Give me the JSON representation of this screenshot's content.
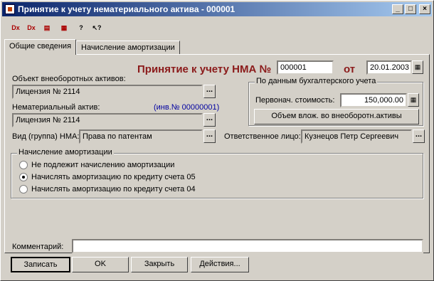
{
  "window": {
    "title": "Принятие к учету нематериального актива - 000001"
  },
  "toolbar": {
    "icons": [
      "delete-doc-icon",
      "delete-mark-icon",
      "doc-edit-icon",
      "doc-list-icon",
      "help-icon",
      "pointer-help-icon"
    ]
  },
  "tabs": {
    "general": "Общие сведения",
    "amortization": "Начисление амортизации"
  },
  "header": {
    "title": "Принятие к учету НМА №",
    "number": "000001",
    "date_label": "от",
    "date": "20.01.2003"
  },
  "asset": {
    "label": "Объект внеоборотных активов:",
    "value": "Лицензия № 2114"
  },
  "nma": {
    "label": "Нематериальный актив:",
    "inv": "(инв.№ 00000001)",
    "value": "Лицензия № 2114"
  },
  "kind": {
    "label": "Вид (группа) НМА:",
    "value": "Права по патентам"
  },
  "accounting": {
    "group_title": "По данным бухгалтерского учета",
    "cost_label": "Первонач. стоимость:",
    "cost": "150,000.00",
    "invest_button": "Объем влож. во внеоборотн.активы"
  },
  "responsible": {
    "label": "Ответственное лицо:",
    "value": "Кузнецов Петр Сергеевич"
  },
  "amort": {
    "group_title": "Начисление амортизации",
    "options": [
      "Не подлежит начислению амортизации",
      "Начислять амортизацию по кредиту счета 05",
      "Начислять амортизацию по кредиту счета 04"
    ],
    "selected": 1
  },
  "comment": {
    "label": "Комментарий:",
    "value": ""
  },
  "buttons": {
    "save": "Записать",
    "ok": "OK",
    "close": "Закрыть",
    "actions": "Действия..."
  }
}
